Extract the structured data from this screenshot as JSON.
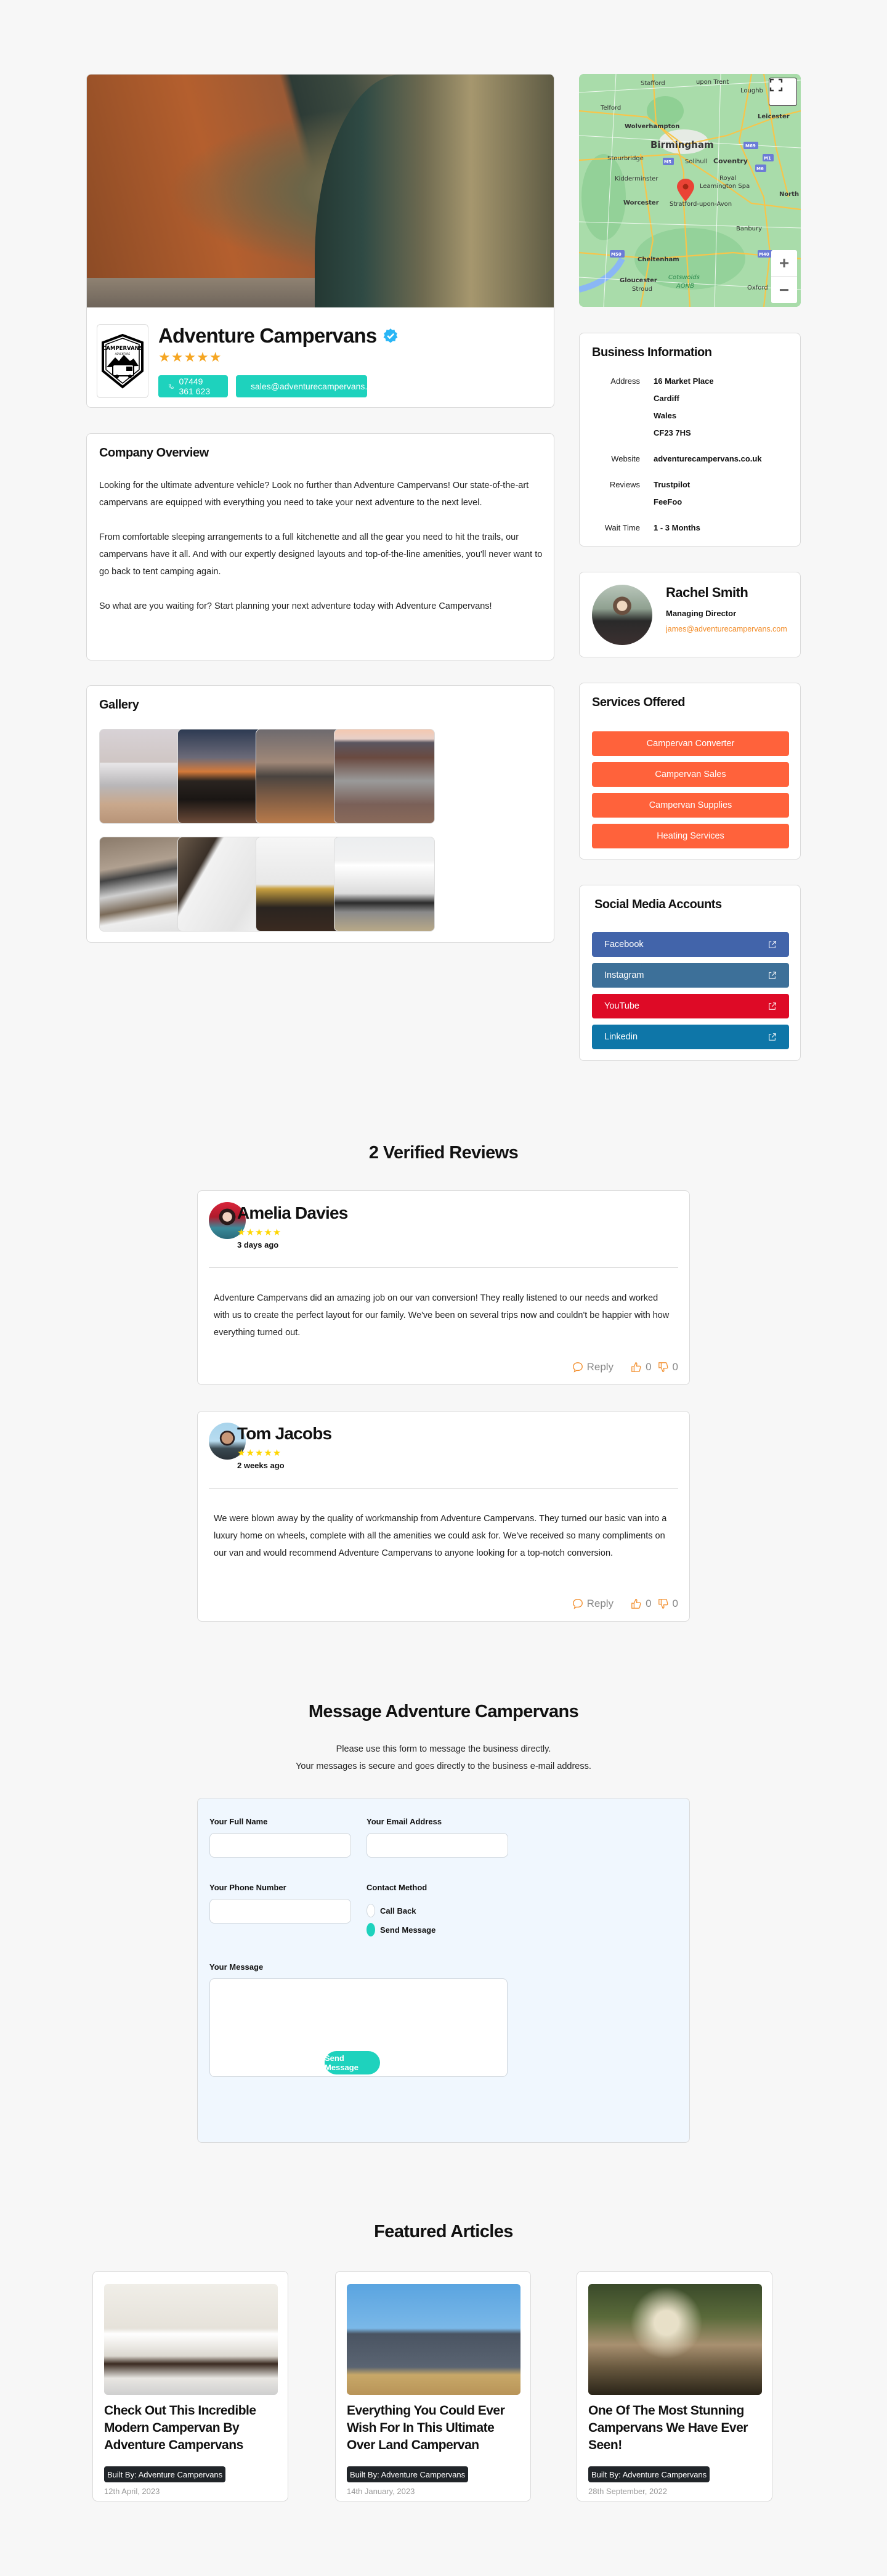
{
  "business": {
    "name": "Adventure Campervans",
    "rating": 5,
    "rating_stars": "★★★★★",
    "phone": "07449 361 623",
    "email": "sales@adventurecampervans.com",
    "logo_text_top": "CAMPERVANS",
    "logo_text_sub": "ADVENTURE"
  },
  "map": {
    "labels": [
      "Stafford",
      "upon Trent",
      "Loughb",
      "Telford",
      "Leicester",
      "Wolverhampton",
      "Birmingham",
      "M69",
      "Stourbridge",
      "M5",
      "Solihull",
      "Coventry",
      "M1",
      "M6",
      "Kidderminster",
      "Royal",
      "Leamington Spa",
      "North",
      "Worcester",
      "Stratford-upon-Avon",
      "Banbury",
      "M50",
      "M40",
      "Cheltenham",
      "Gloucester",
      "Cotswolds",
      "AONB",
      "Stroud",
      "Oxford"
    ],
    "zoom_in": "+",
    "zoom_out": "−"
  },
  "business_info": {
    "title": "Business Information",
    "rows": [
      {
        "label": "Address",
        "values": [
          "16 Market Place",
          "Cardiff",
          "Wales",
          "CF23 7HS"
        ]
      },
      {
        "label": "Website",
        "values": [
          "adventurecampervans.co.uk"
        ]
      },
      {
        "label": "Reviews",
        "values": [
          "Trustpilot",
          "FeeFoo"
        ]
      },
      {
        "label": "Wait Time",
        "values": [
          "1 - 3 Months"
        ]
      }
    ]
  },
  "overview": {
    "title": "Company Overview",
    "paragraphs": [
      "Looking for the ultimate adventure vehicle? Look no further than Adventure Campervans! Our state-of-the-art campervans are equipped with everything you need to take your next adventure to the next level.",
      "From comfortable sleeping arrangements to a full kitchenette and all the gear you need to hit the trails, our campervans have it all. And with our expertly designed layouts and top-of-the-line amenities, you'll never want to go back to tent camping again.",
      "So what are you waiting for? Start planning your next adventure today with Adventure Campervans!"
    ]
  },
  "gallery": {
    "title": "Gallery",
    "images": [
      "Van with awning and family",
      "Vans with headlights at dusk",
      "Vans in desert at dusk",
      "Van on canyon cliff",
      "Wooden ceiling with roof vent",
      "White cabinets with wood countertop",
      "Gold faucet and tiled kitchen",
      "White van with sliding door"
    ]
  },
  "contact_person": {
    "name": "Rachel Smith",
    "role": "Managing Director",
    "email": "james@adventurecampervans.com"
  },
  "services": {
    "title": "Services Offered",
    "items": [
      "Campervan Converter",
      "Campervan Sales",
      "Campervan Supplies",
      "Heating Services"
    ],
    "color": "#ff623b"
  },
  "social": {
    "title": "Social Media Accounts",
    "items": [
      {
        "label": "Facebook",
        "color": "#4264aa"
      },
      {
        "label": "Instagram",
        "color": "#3d7099"
      },
      {
        "label": "YouTube",
        "color": "#de0a26"
      },
      {
        "label": "Linkedin",
        "color": "#0e76a8"
      }
    ]
  },
  "reviews": {
    "title": "2 Verified Reviews",
    "items": [
      {
        "name": "Amelia Davies",
        "stars": "★★★★★",
        "date": "3 days ago",
        "body": "Adventure Campervans did an amazing job on our van conversion! They really listened to our needs and worked with us to create the perfect layout for our family. We've been on several trips now and couldn't be happier with how everything turned out.",
        "reply_label": "Reply",
        "likes": "0",
        "dislikes": "0"
      },
      {
        "name": "Tom Jacobs",
        "stars": "★★★★★",
        "date": "2 weeks ago",
        "body": "We were blown away by the quality of workmanship from Adventure Campervans. They turned our basic van into a luxury home on wheels, complete with all the amenities we could ask for. We've received so many compliments on our van and would recommend Adventure Campervans to anyone looking for a top-notch conversion.",
        "reply_label": "Reply",
        "likes": "0",
        "dislikes": "0"
      }
    ]
  },
  "message_form": {
    "title": "Message Adventure Campervans",
    "subtitle_1": "Please use this form to message the business directly.",
    "subtitle_2": "Your messages is secure and goes directly to the business e-mail address.",
    "full_name_label": "Your Full Name",
    "full_name_value": "",
    "email_label": "Your Email Address",
    "email_value": "",
    "phone_label": "Your Phone Number",
    "phone_value": "",
    "contact_method_label": "Contact Method",
    "contact_options": [
      "Call Back",
      "Send Message"
    ],
    "contact_selected": "Send Message",
    "message_label": "Your Message",
    "message_value": "",
    "submit_label": "Send Message"
  },
  "articles": {
    "title": "Featured Articles",
    "items": [
      {
        "title": "Check Out This Incredible Modern Campervan By Adventure Campervans",
        "badge": "Built By: Adventure Campervans",
        "date": "12th April, 2023"
      },
      {
        "title": "Everything You Could Ever Wish For In This Ultimate Over Land Campervan",
        "badge": "Built By: Adventure Campervans",
        "date": "14th January, 2023"
      },
      {
        "title": "One Of The Most Stunning Campervans We Have Ever Seen!",
        "badge": "Built By: Adventure Campervans",
        "date": "28th September, 2022"
      }
    ]
  },
  "colors": {
    "accent_teal": "#1ed2bd",
    "star_orange": "#f5a623",
    "star_yellow": "#ffd600",
    "link_orange": "#f28c28",
    "verified_blue": "#29b6f6"
  }
}
